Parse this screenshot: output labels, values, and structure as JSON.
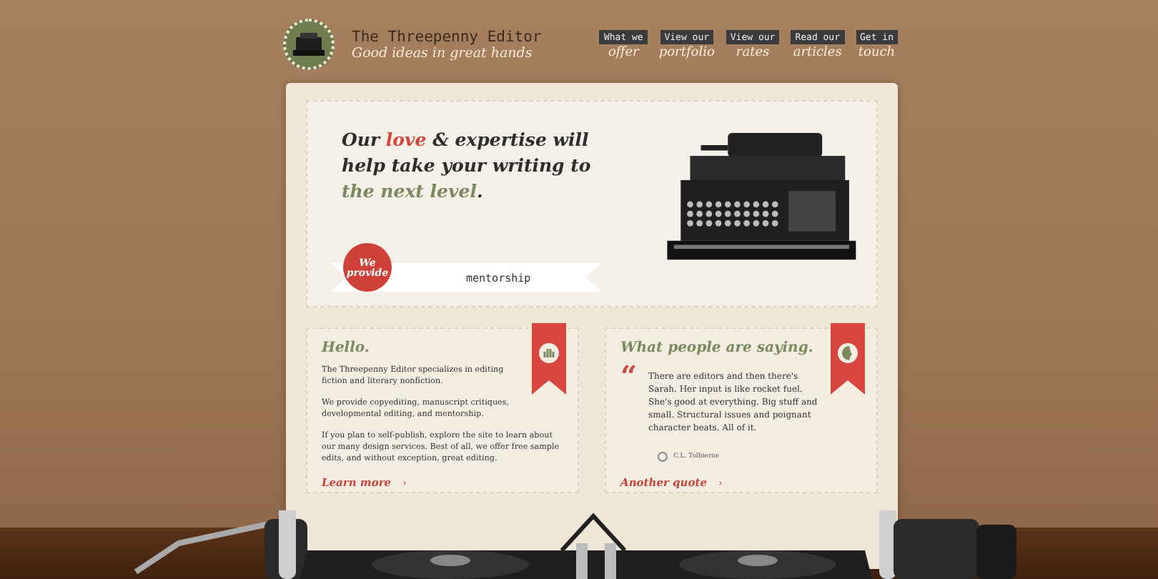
{
  "header": {
    "title": "The Threepenny Editor",
    "tagline": "Good ideas in great hands",
    "nav": [
      {
        "small": "What we",
        "big": "offer"
      },
      {
        "small": "View our",
        "big": "portfolio"
      },
      {
        "small": "View our",
        "big": "rates"
      },
      {
        "small": "Read our",
        "big": "articles"
      },
      {
        "small": "Get in",
        "big": "touch"
      }
    ]
  },
  "hero": {
    "headline": [
      {
        "text": "Our ",
        "color": "#2d2d2d"
      },
      {
        "text": "love",
        "color": "#d2473e"
      },
      {
        "text": " & expertise will help take your writing to ",
        "color": "#2d2d2d"
      },
      {
        "text": "the next level",
        "color": "#7a8a5e"
      },
      {
        "text": ".",
        "color": "#2d2d2d"
      }
    ],
    "badge": "We provide",
    "service": "mentorship"
  },
  "hello": {
    "title": "Hello.",
    "paragraphs": [
      "The Threepenny Editor specializes in editing fiction and literary nonfiction.",
      "We provide copyediting, manuscript critiques, developmental editing, and mentorship.",
      "If you plan to self-publish, explore the site to learn about our many design services. Best of all, we offer free sample edits, and without exception, great editing."
    ],
    "link": "Learn more",
    "link_arrow": "›"
  },
  "testimonial": {
    "title": "What people are saying.",
    "quote_mark": "“",
    "quote": "There are editors and then there's Sarah. Her input is like rocket fuel. She's good at everything. Big stuff and small. Structural issues and poignant character beats. All of it.",
    "author": "C.L. Tolbierne",
    "link": "Another quote",
    "link_arrow": "›"
  }
}
